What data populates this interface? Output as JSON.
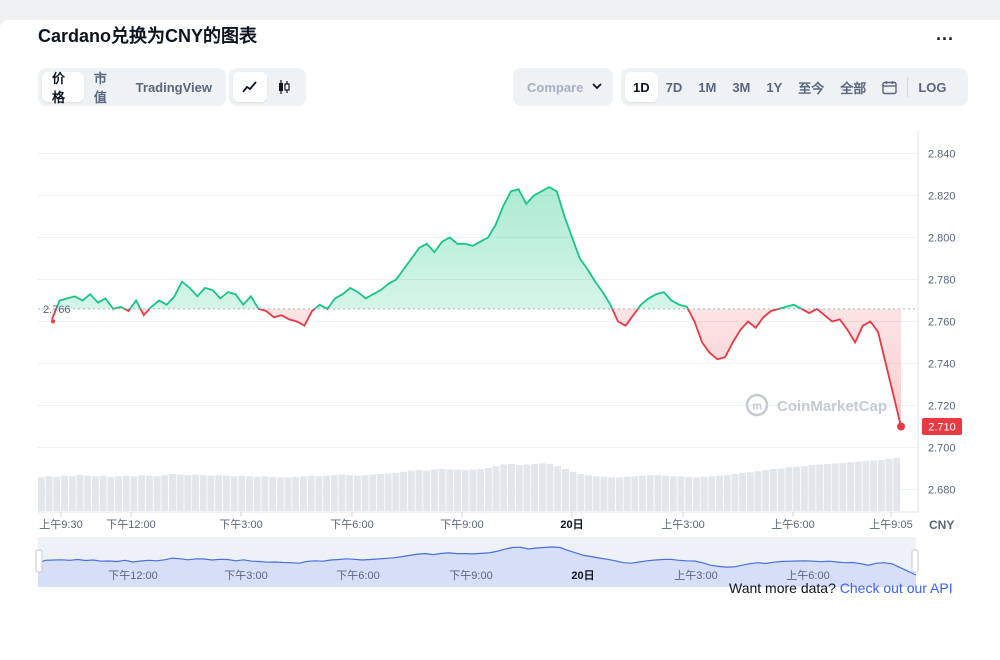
{
  "title": "Cardano兑换为CNY的图表",
  "more_label": "...",
  "view_tabs": [
    {
      "label": "价格",
      "active": true
    },
    {
      "label": "市值",
      "active": false
    },
    {
      "label": "TradingView",
      "active": false
    }
  ],
  "chart_type_icons": [
    "line-chart-icon",
    "candlestick-icon"
  ],
  "compare_label": "Compare",
  "range_tabs": [
    {
      "label": "1D",
      "active": true
    },
    {
      "label": "7D",
      "active": false
    },
    {
      "label": "1M",
      "active": false
    },
    {
      "label": "3M",
      "active": false
    },
    {
      "label": "1Y",
      "active": false
    },
    {
      "label": "至今",
      "active": false
    },
    {
      "label": "全部",
      "active": false
    }
  ],
  "log_label": "LOG",
  "watermark": "CoinMarketCap",
  "currency_label": "CNY",
  "api_text": "Want more data?",
  "api_link": "Check out our API",
  "colors": {
    "up": "#16c784",
    "down": "#ea3943",
    "accent": "#3861fb"
  },
  "chart_data": {
    "type": "line",
    "baseline": 2.766,
    "baseline_label": "2.766",
    "last_value": 2.71,
    "last_label": "2.710",
    "ylim": [
      2.675,
      2.845
    ],
    "yticks": [
      "2.840",
      "2.820",
      "2.800",
      "2.780",
      "2.760",
      "2.740",
      "2.720",
      "2.700",
      "2.680"
    ],
    "xticks": [
      "上午9:30",
      "下午12:00",
      "下午3:00",
      "下午6:00",
      "下午9:00",
      "20日",
      "上午3:00",
      "上午6:00",
      "上午9:05"
    ],
    "navigator_xticks": [
      "下午12:00",
      "下午3:00",
      "下午6:00",
      "下午9:00",
      "20日",
      "上午3:00",
      "上午6:00"
    ],
    "values": [
      2.761,
      2.77,
      2.771,
      2.772,
      2.77,
      2.773,
      2.769,
      2.771,
      2.766,
      2.767,
      2.765,
      2.77,
      2.763,
      2.767,
      2.77,
      2.768,
      2.772,
      2.779,
      2.776,
      2.772,
      2.776,
      2.775,
      2.771,
      2.774,
      2.773,
      2.768,
      2.772,
      2.766,
      2.765,
      2.762,
      2.763,
      2.761,
      2.76,
      2.758,
      2.765,
      2.768,
      2.766,
      2.771,
      2.773,
      2.776,
      2.774,
      2.771,
      2.773,
      2.775,
      2.778,
      2.78,
      2.785,
      2.79,
      2.795,
      2.797,
      2.793,
      2.798,
      2.8,
      2.797,
      2.797,
      2.796,
      2.798,
      2.8,
      2.806,
      2.815,
      2.822,
      2.823,
      2.816,
      2.82,
      2.822,
      2.824,
      2.822,
      2.81,
      2.8,
      2.79,
      2.785,
      2.779,
      2.774,
      2.768,
      2.76,
      2.758,
      2.763,
      2.768,
      2.771,
      2.773,
      2.774,
      2.77,
      2.768,
      2.767,
      2.76,
      2.75,
      2.745,
      2.742,
      2.743,
      2.75,
      2.756,
      2.76,
      2.757,
      2.762,
      2.765,
      2.766,
      2.767,
      2.768,
      2.766,
      2.764,
      2.766,
      2.763,
      2.76,
      2.761,
      2.756,
      2.75,
      2.758,
      2.76,
      2.755,
      2.74,
      2.725,
      2.71
    ],
    "volume": [
      0.6,
      0.62,
      0.61,
      0.63,
      0.62,
      0.64,
      0.63,
      0.62,
      0.63,
      0.61,
      0.62,
      0.63,
      0.62,
      0.64,
      0.63,
      0.62,
      0.64,
      0.66,
      0.65,
      0.64,
      0.65,
      0.64,
      0.63,
      0.64,
      0.63,
      0.62,
      0.63,
      0.62,
      0.61,
      0.62,
      0.61,
      0.6,
      0.6,
      0.61,
      0.62,
      0.63,
      0.62,
      0.63,
      0.64,
      0.65,
      0.64,
      0.63,
      0.64,
      0.65,
      0.66,
      0.67,
      0.68,
      0.7,
      0.72,
      0.73,
      0.72,
      0.74,
      0.75,
      0.74,
      0.74,
      0.73,
      0.74,
      0.75,
      0.77,
      0.8,
      0.83,
      0.84,
      0.82,
      0.83,
      0.84,
      0.85,
      0.84,
      0.8,
      0.75,
      0.7,
      0.66,
      0.64,
      0.62,
      0.61,
      0.6,
      0.6,
      0.61,
      0.62,
      0.63,
      0.64,
      0.64,
      0.63,
      0.62,
      0.62,
      0.61,
      0.6,
      0.61,
      0.62,
      0.63,
      0.64,
      0.66,
      0.68,
      0.69,
      0.71,
      0.73,
      0.75,
      0.76,
      0.78,
      0.79,
      0.8,
      0.82,
      0.83,
      0.84,
      0.85,
      0.86,
      0.87,
      0.88,
      0.89,
      0.9,
      0.91,
      0.93,
      0.95
    ]
  }
}
